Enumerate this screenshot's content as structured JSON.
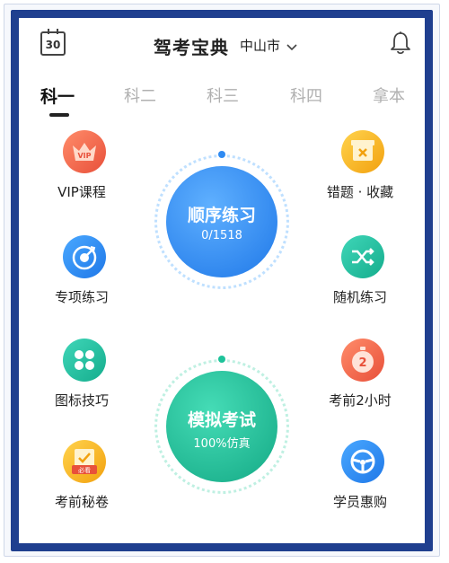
{
  "header": {
    "calendar_day": "30",
    "app_title": "驾考宝典",
    "city": "中山市",
    "city_icon": "chevron-down-icon",
    "notification_icon": "bell-icon"
  },
  "tabs": [
    {
      "label": "科一",
      "active": true
    },
    {
      "label": "科二"
    },
    {
      "label": "科三"
    },
    {
      "label": "科四"
    },
    {
      "label": "拿本"
    }
  ],
  "left_features": [
    {
      "label": "VIP课程",
      "badge": "VIP",
      "icon": "vip-crown-icon",
      "color": "#f06a4a"
    },
    {
      "label": "专项练习",
      "icon": "target-icon",
      "color": "#2b8ef0"
    },
    {
      "label": "图标技巧",
      "icon": "grid-dots-icon",
      "color": "#1ec0a0"
    },
    {
      "label": "考前秘卷",
      "badge": "必看",
      "icon": "secret-paper-icon",
      "color": "#f5b31a"
    }
  ],
  "right_features": [
    {
      "label": "错题 · 收藏",
      "icon": "wrong-questions-icon",
      "color": "#f5b31a"
    },
    {
      "label": "随机练习",
      "icon": "shuffle-icon",
      "color": "#1ec0a0"
    },
    {
      "label": "考前2小时",
      "badge": "2",
      "icon": "clock-icon",
      "color": "#f06a4a"
    },
    {
      "label": "学员惠购",
      "icon": "steering-wheel-icon",
      "color": "#2b8ef0"
    }
  ],
  "practice": {
    "title": "顺序练习",
    "progress_text": "0/1518",
    "color": "#2f8bf2"
  },
  "exam": {
    "title": "模拟考试",
    "subtitle": "100%仿真",
    "color": "#1ec39a"
  }
}
